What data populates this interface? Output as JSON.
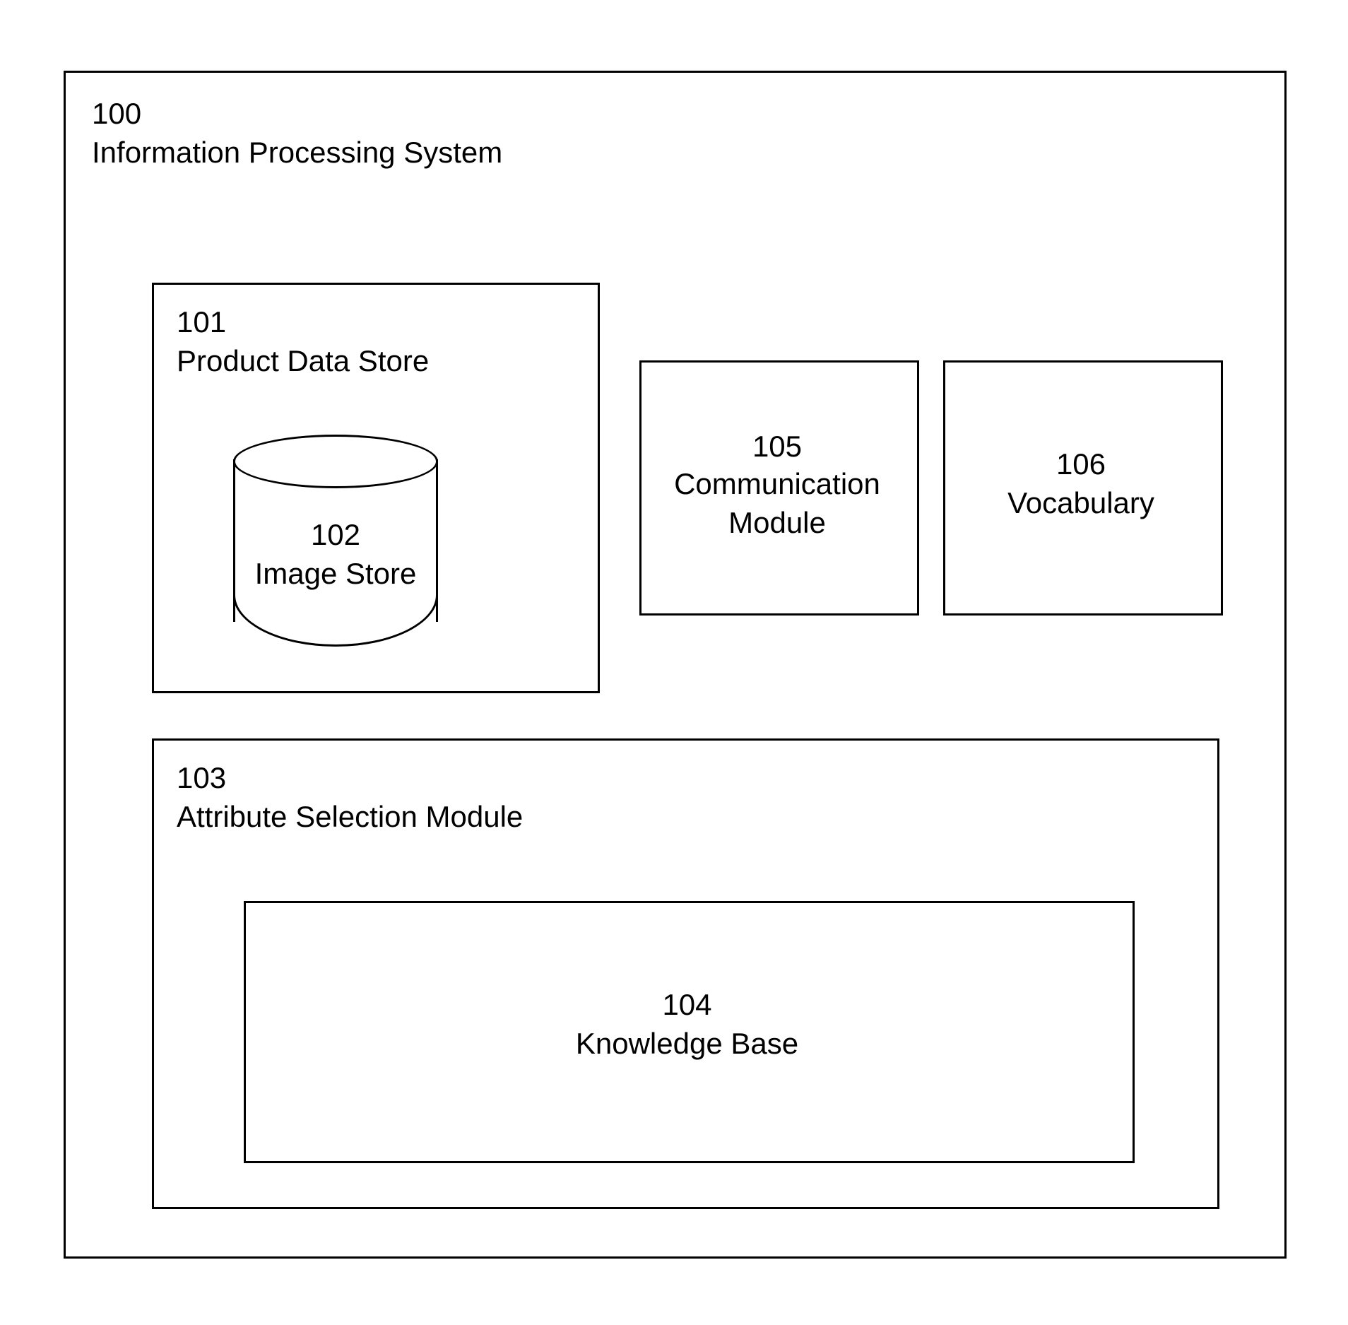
{
  "blocks": {
    "system": {
      "id": "100",
      "name": "Information Processing System"
    },
    "store": {
      "id": "101",
      "name": "Product Data Store"
    },
    "image": {
      "id": "102",
      "name": "Image Store"
    },
    "attr": {
      "id": "103",
      "name": "Attribute Selection Module"
    },
    "kb": {
      "id": "104",
      "name": "Knowledge Base"
    },
    "comm": {
      "id": "105",
      "name": "Communication\nModule"
    },
    "vocab": {
      "id": "106",
      "name": "Vocabulary"
    }
  }
}
